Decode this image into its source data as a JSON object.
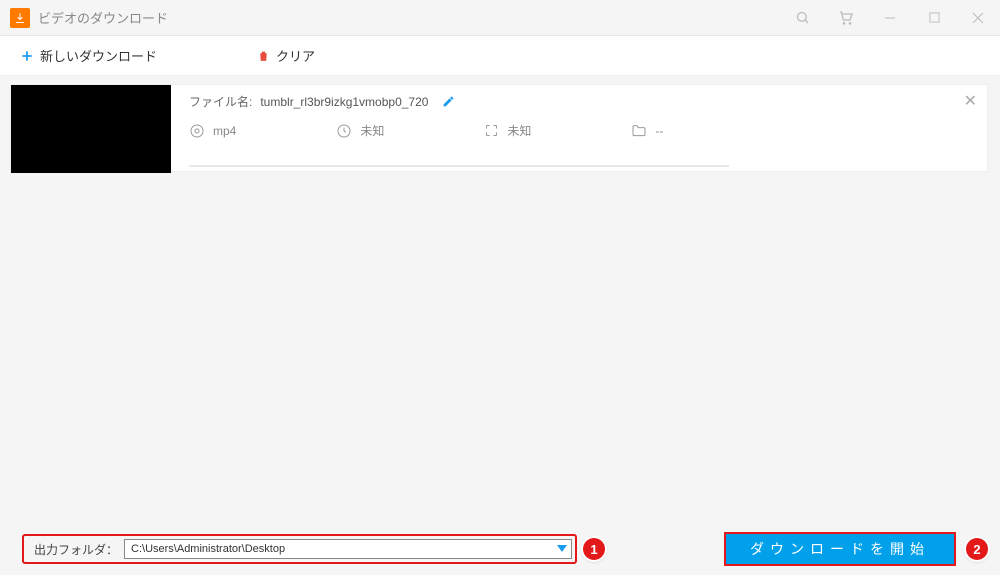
{
  "window": {
    "title": "ビデオのダウンロード"
  },
  "toolbar": {
    "new_download": "新しいダウンロード",
    "clear": "クリア"
  },
  "item": {
    "filename_label": "ファイル名:",
    "filename": "tumblr_rl3br9izkg1vmobp0_720",
    "format": "mp4",
    "duration": "未知",
    "resolution": "未知",
    "folder": "--"
  },
  "footer": {
    "output_label": "出力フォルダ：",
    "output_path": "C:\\Users\\Administrator\\Desktop",
    "start_label": "ダウンロードを開始"
  },
  "callouts": {
    "one": "1",
    "two": "2"
  }
}
